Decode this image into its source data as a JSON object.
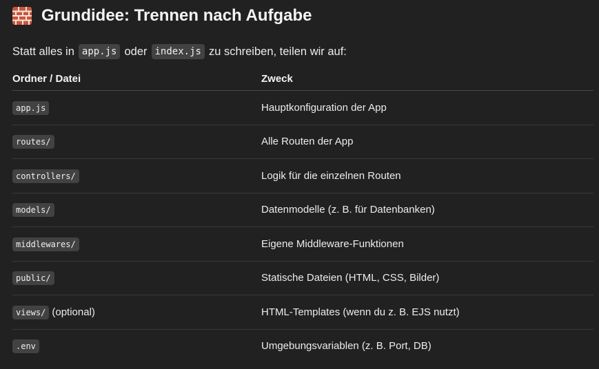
{
  "heading": {
    "icon": "brick-icon",
    "text": "Grundidee: Trennen nach Aufgabe"
  },
  "intro": {
    "before": "Statt alles in",
    "code1": "app.js",
    "middle": "oder",
    "code2": "index.js",
    "after": "zu schreiben, teilen wir auf:"
  },
  "table": {
    "headers": [
      "Ordner / Datei",
      "Zweck"
    ],
    "rows": [
      {
        "code": "app.js",
        "suffix": "",
        "purpose": "Hauptkonfiguration der App"
      },
      {
        "code": "routes/",
        "suffix": "",
        "purpose": "Alle Routen der App"
      },
      {
        "code": "controllers/",
        "suffix": "",
        "purpose": "Logik für die einzelnen Routen"
      },
      {
        "code": "models/",
        "suffix": "",
        "purpose": "Datenmodelle (z. B. für Datenbanken)"
      },
      {
        "code": "middlewares/",
        "suffix": "",
        "purpose": "Eigene Middleware-Funktionen"
      },
      {
        "code": "public/",
        "suffix": "",
        "purpose": "Statische Dateien (HTML, CSS, Bilder)"
      },
      {
        "code": "views/",
        "suffix": "(optional)",
        "purpose": "HTML-Templates (wenn du z. B. EJS nutzt)"
      },
      {
        "code": ".env",
        "suffix": "",
        "purpose": "Umgebungsvariablen (z. B. Port, DB)"
      }
    ]
  }
}
